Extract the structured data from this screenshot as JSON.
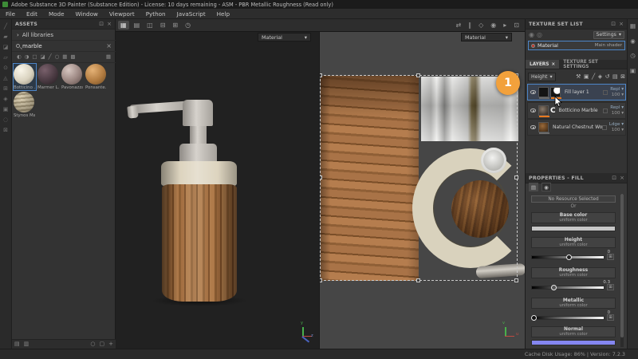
{
  "title_bar": {
    "title": "Adobe Substance 3D Painter (Substance Edition) - License: 10 days remaining - ASM - PBR Metallic Roughness (Read only)"
  },
  "menu_bar": {
    "items": [
      "File",
      "Edit",
      "Mode",
      "Window",
      "Viewport",
      "Python",
      "JavaScript",
      "Help"
    ]
  },
  "left_toolbar": {
    "icons": [
      "╱",
      "▰",
      "◪",
      "▱",
      "⊙",
      "◬",
      "⊞",
      "◈",
      "▣",
      "◌",
      "⊠"
    ]
  },
  "assets_panel": {
    "title": "ASSETS",
    "header_icons": {
      "dock": "⊡",
      "close": "×"
    },
    "library_row": {
      "chevron": "›",
      "label": "All libraries"
    },
    "search": {
      "value": "marble",
      "clear": "×"
    },
    "filter_icons": [
      "◐",
      "◑",
      "□",
      "◪",
      "╱",
      "○",
      "▦",
      "▩"
    ],
    "grid_icon": "▦",
    "assets": [
      {
        "label": "Botticino ..."
      },
      {
        "label": "Marmer L..."
      },
      {
        "label": "Pavonazza..."
      },
      {
        "label": "Ponsante..."
      },
      {
        "label": "Stynos Mar..."
      }
    ],
    "footer_icons": [
      "▤",
      "▥"
    ],
    "footer_right_icons": [
      "○",
      "▢",
      "+"
    ]
  },
  "viewport": {
    "toolbar_left_icons": [
      "▦",
      "▤",
      "◫",
      "⊟",
      "⊞",
      "◷"
    ],
    "toolbar_right_icons": [
      "⇄",
      "∥",
      "◇",
      "◉",
      "▸",
      "⊡"
    ],
    "view3d": {
      "material_selector": "Material",
      "chevron": "▾",
      "gizmo": {
        "up": "y",
        "depth": "z"
      }
    },
    "view2d": {
      "material_selector": "Material",
      "chevron": "▾",
      "gizmo": {
        "up": "v",
        "right": "u"
      }
    }
  },
  "texture_set_list": {
    "title": "TEXTURE SET LIST",
    "header_icons": {
      "dock": "⊡",
      "close": "×"
    },
    "row_icons": [
      "◉",
      "◎"
    ],
    "settings": {
      "label": "Settings",
      "chevron": "▾"
    },
    "material": {
      "name": "Material",
      "shader": "Main shader"
    }
  },
  "layers_panel": {
    "tabs": {
      "layers": "LAYERS",
      "layers_close": "×",
      "settings": "TEXTURE SET SETTINGS"
    },
    "channel_filter": {
      "value": "Height",
      "chevron": "▾"
    },
    "toolbar_icons": [
      "⚒",
      "▣",
      "╱",
      "◈",
      "↺",
      "▤",
      "⊠"
    ],
    "rows": [
      {
        "name": "Fill layer 1",
        "blend": "Repl",
        "opacity": "100",
        "chevron": "▾",
        "mask_glyph": ""
      },
      {
        "name": "Botticino Marble",
        "blend": "Repl",
        "opacity": "100",
        "chevron": "▾",
        "mask_glyph": "C"
      },
      {
        "name": "Natural Chestnut Wood",
        "blend": "Ldge",
        "opacity": "100",
        "chevron": "▾",
        "mask_glyph": ""
      }
    ],
    "accent_underline_color": "#e8781e"
  },
  "properties_panel": {
    "title": "PROPERTIES - FILL",
    "header_icons": {
      "dock": "⊡",
      "close": "×"
    },
    "tab_icons": [
      "▤",
      "◉"
    ],
    "no_resource": "No Resource Selected",
    "or_label": "Or",
    "stepper_glyph": "⊞",
    "channels": {
      "base_color": {
        "name": "Base color",
        "mode": "uniform color",
        "swatch": "#c6c6c6"
      },
      "height": {
        "name": "Height",
        "mode": "uniform color",
        "value": "0"
      },
      "roughness": {
        "name": "Roughness",
        "mode": "uniform color",
        "value": "0.3"
      },
      "metallic": {
        "name": "Metallic",
        "mode": "uniform color",
        "value": "0"
      },
      "normal": {
        "name": "Normal",
        "mode": "uniform color",
        "swatch": "#8486f0"
      }
    }
  },
  "right_dock": {
    "icons": [
      "▦",
      "◉",
      "◷",
      "▣"
    ]
  },
  "annotation": {
    "step": "1"
  },
  "status_bar": {
    "text": "Cache Disk Usage:  86% | Version: 7.2.3"
  }
}
